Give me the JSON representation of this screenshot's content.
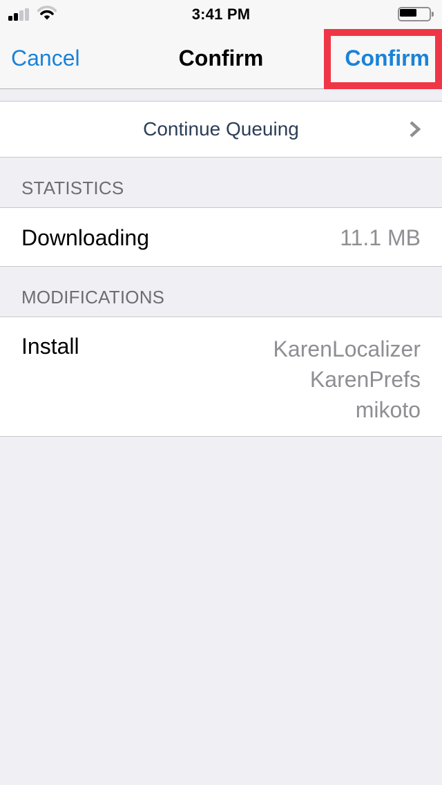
{
  "status_bar": {
    "time": "3:41 PM",
    "signal_bars_total": 4,
    "signal_bars_filled": 2,
    "wifi_icon": "wifi-icon",
    "battery_level_percent": 60
  },
  "nav": {
    "cancel_label": "Cancel",
    "title": "Confirm",
    "confirm_label": "Confirm",
    "accent_color": "#1a82d8",
    "highlight_color": "#ef3646"
  },
  "continue_queuing": {
    "label": "Continue Queuing",
    "icon": "chevron-right-icon"
  },
  "statistics": {
    "header": "STATISTICS",
    "rows": [
      {
        "label": "Downloading",
        "value": "11.1 MB"
      }
    ]
  },
  "modifications": {
    "header": "MODIFICATIONS",
    "install_label": "Install",
    "packages": [
      "KarenLocalizer",
      "KarenPrefs",
      "mikoto"
    ]
  }
}
